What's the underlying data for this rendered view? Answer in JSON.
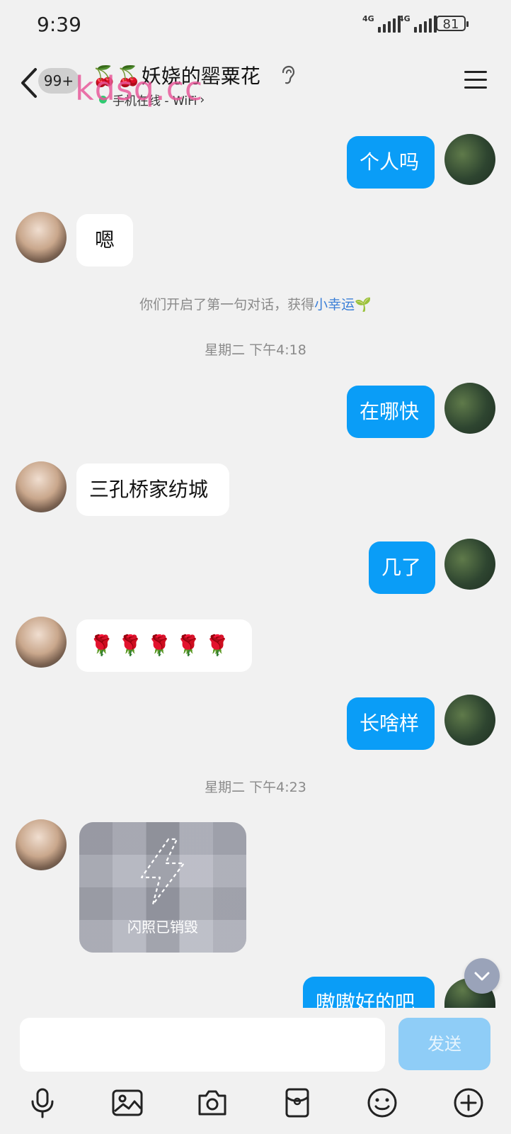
{
  "status_bar": {
    "time": "9:39",
    "signal1": "4G",
    "signal2": "4G",
    "battery": "81"
  },
  "header": {
    "unread_badge": "99+",
    "title": "🍒🍒妖娆的罂粟花",
    "subtitle": "手机在线 - WiFi",
    "watermark": "kdsq.cc"
  },
  "messages": [
    {
      "side": "me",
      "text": "个人吗"
    },
    {
      "side": "them",
      "text": "嗯"
    },
    {
      "side": "me",
      "text": "在哪快"
    },
    {
      "side": "them",
      "text": "三孔桥家纺城"
    },
    {
      "side": "me",
      "text": "几了"
    },
    {
      "side": "them",
      "text": "🌹🌹🌹🌹🌹"
    },
    {
      "side": "me",
      "text": "长啥样"
    },
    {
      "side": "me",
      "text": "嗷嗷好的吧"
    }
  ],
  "system": {
    "first_talk": "你们开启了第一句对话，获得",
    "lucky": "小幸运",
    "lucky_emoji": "🌱",
    "time1": "星期二 下午4:18",
    "time2": "星期二 下午4:23"
  },
  "flash_photo": {
    "label": "闪照已销毁"
  },
  "input": {
    "placeholder": "",
    "send_label": "发送"
  },
  "toolbar_icons": [
    "microphone-icon",
    "image-icon",
    "camera-icon",
    "red-packet-icon",
    "emoji-icon",
    "plus-icon"
  ],
  "colors": {
    "my_bubble": "#0a9df7",
    "their_bubble": "#ffffff",
    "background": "#f1f1f1",
    "send_button": "#8fcdf7",
    "link": "#3b7fd7",
    "watermark": "#e85a9b"
  }
}
